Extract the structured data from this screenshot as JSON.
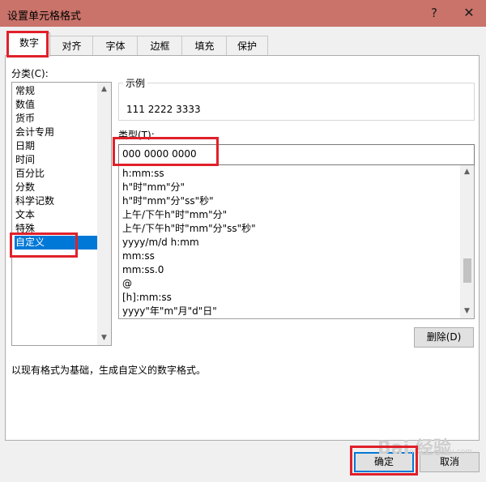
{
  "window": {
    "title": "设置单元格格式",
    "help_glyph": "?",
    "close_glyph": "✕",
    "titlebar_color": "#c9736a"
  },
  "tabs": [
    {
      "label": "数字",
      "active": true
    },
    {
      "label": "对齐",
      "active": false
    },
    {
      "label": "字体",
      "active": false
    },
    {
      "label": "边框",
      "active": false
    },
    {
      "label": "填充",
      "active": false
    },
    {
      "label": "保护",
      "active": false
    }
  ],
  "category": {
    "label": "分类(C):",
    "items": [
      "常规",
      "数值",
      "货币",
      "会计专用",
      "日期",
      "时间",
      "百分比",
      "分数",
      "科学记数",
      "文本",
      "特殊",
      "自定义"
    ],
    "selected": "自定义"
  },
  "sample": {
    "group_label": "示例",
    "value": "111 2222 3333"
  },
  "type": {
    "label": "类型(T):",
    "value": "000 0000 0000"
  },
  "formats": [
    "h:mm:ss",
    "h\"时\"mm\"分\"",
    "h\"时\"mm\"分\"ss\"秒\"",
    "上午/下午h\"时\"mm\"分\"",
    "上午/下午h\"时\"mm\"分\"ss\"秒\"",
    "yyyy/m/d h:mm",
    "mm:ss",
    "mm:ss.0",
    "@",
    "[h]:mm:ss",
    "yyyy\"年\"m\"月\"d\"日\""
  ],
  "buttons": {
    "delete": "删除(D)",
    "ok": "确定",
    "cancel": "取消"
  },
  "description": "以现有格式为基础，生成自定义的数字格式。",
  "watermark": {
    "text": "Bai 经验",
    "sub": "jingyan.baidu.com"
  },
  "colors": {
    "highlight": "#e0202a",
    "selection": "#0078d7"
  }
}
